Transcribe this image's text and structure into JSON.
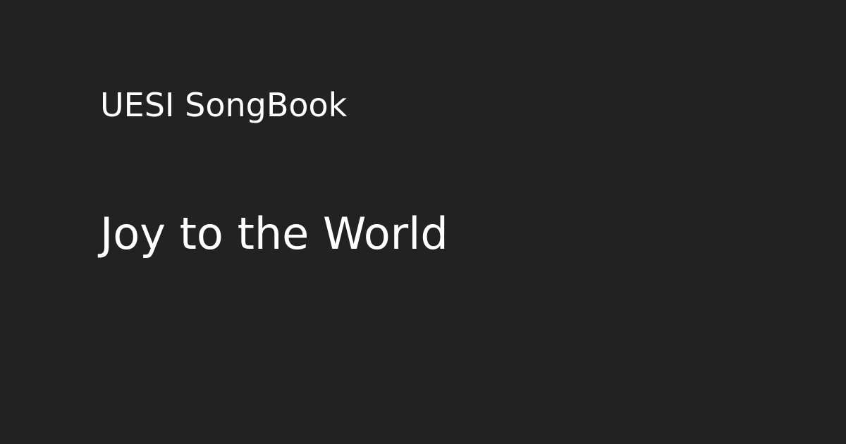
{
  "colors": {
    "background": "#222222",
    "text": "#ffffff"
  },
  "header": {
    "site_name": "UESI SongBook"
  },
  "main": {
    "song_title": "Joy to the World"
  }
}
